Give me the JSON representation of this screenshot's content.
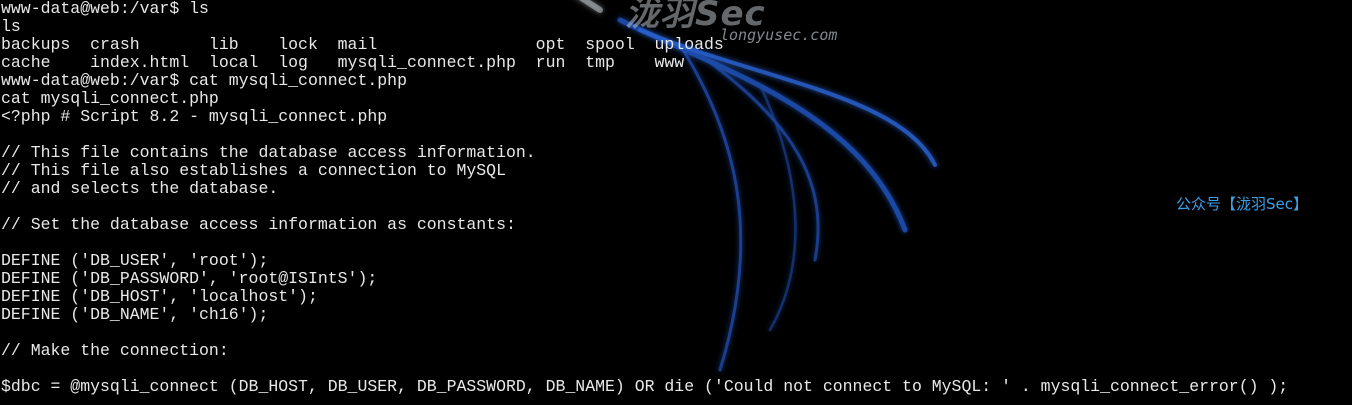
{
  "terminal": {
    "lines": [
      "www-data@web:/var$ ls",
      "ls",
      "backups  crash       lib    lock  mail                opt  spool  uploads",
      "cache    index.html  local  log   mysqli_connect.php  run  tmp    www",
      "www-data@web:/var$ cat mysqli_connect.php",
      "cat mysqli_connect.php",
      "<?php # Script 8.2 - mysqli_connect.php",
      "",
      "// This file contains the database access information.",
      "// This file also establishes a connection to MySQL",
      "// and selects the database.",
      "",
      "// Set the database access information as constants:",
      "",
      "DEFINE ('DB_USER', 'root');",
      "DEFINE ('DB_PASSWORD', 'root@ISIntS');",
      "DEFINE ('DB_HOST', 'localhost');",
      "DEFINE ('DB_NAME', 'ch16');",
      "",
      "// Make the connection:",
      "",
      "$dbc = @mysqli_connect (DB_HOST, DB_USER, DB_PASSWORD, DB_NAME) OR die ('Could not connect to MySQL: ' . mysqli_connect_error() );"
    ]
  },
  "watermark": {
    "brand": "泷羽Sec",
    "site": "longyusec.com",
    "account": "公众号【泷羽Sec】",
    "accent_color": "#2f6fd6",
    "logo_icon": "dragon-swirl-logo-icon"
  },
  "colors": {
    "background": "#000000",
    "text": "#e8e8e8"
  }
}
